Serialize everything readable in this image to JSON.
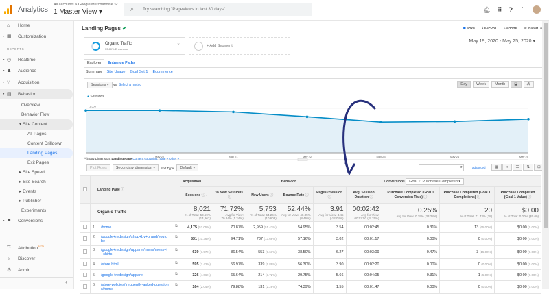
{
  "topbar": {
    "brand": "Analytics",
    "breadcrumb": "All accounts > Google Merchandise St...",
    "view": "1 Master View",
    "search_placeholder": "Try searching \"Pageviews in last 30 days\""
  },
  "sidebar": {
    "home": "Home",
    "customization": "Customization",
    "reports_header": "REPORTS",
    "realtime": "Realtime",
    "audience": "Audience",
    "acquisition": "Acquisition",
    "behavior": "Behavior",
    "overview": "Overview",
    "behavior_flow": "Behavior Flow",
    "site_content": "Site Content",
    "all_pages": "All Pages",
    "content_drilldown": "Content Drilldown",
    "landing_pages": "Landing Pages",
    "exit_pages": "Exit Pages",
    "site_speed": "Site Speed",
    "site_search": "Site Search",
    "events": "Events",
    "publisher": "Publisher",
    "experiments": "Experiments",
    "conversions": "Conversions",
    "attribution": "Attribution",
    "beta": "BETA",
    "discover": "Discover",
    "admin": "Admin"
  },
  "report": {
    "title": "Landing Pages",
    "save": "SAVE",
    "export": "EXPORT",
    "share": "SHARE",
    "insights": "INSIGHTS",
    "date_range": "May 19, 2020 - May 25, 2020"
  },
  "segments": {
    "name": "Organic Traffic",
    "detail": "53.60% Entrances",
    "add": "+ Add Segment"
  },
  "tabs": {
    "explorer": "Explorer",
    "entrance_paths": "Entrance Paths"
  },
  "subtabs": [
    "Summary",
    "Site Usage",
    "Goal Set 1",
    "Ecommerce"
  ],
  "chart_controls": {
    "metric": "Sessions",
    "vs": "vs.",
    "select_metric": "Select a metric",
    "day": "Day",
    "week": "Week",
    "month": "Month",
    "legend": "Sessions"
  },
  "chart_data": {
    "type": "area",
    "series": [
      {
        "name": "Sessions",
        "values": [
          1420,
          1420,
          1370,
          1210,
          1030,
          1050,
          1130
        ]
      }
    ],
    "x": [
      "May 19",
      "May 20",
      "May 21",
      "May 22",
      "May 23",
      "May 24",
      "May 25"
    ],
    "x_tick_labels": [
      "...",
      "May 20",
      "May 21",
      "May 22",
      "May 23",
      "May 24",
      "May 25"
    ],
    "y_ticks": [
      "1,500",
      "1,000",
      "500"
    ],
    "ylim": [
      0,
      1500
    ],
    "color": "#058dc7"
  },
  "dimension": {
    "label": "Primary Dimension:",
    "value": "Landing Page",
    "grouping": "Content Grouping: none",
    "other": "Other"
  },
  "controls": {
    "plot_rows": "Plot Rows",
    "secondary": "Secondary dimension",
    "sort_type": "Sort Type:",
    "sort_value": "Default",
    "advanced": "advanced"
  },
  "table": {
    "group_acq": "Acquisition",
    "group_beh": "Behavior",
    "group_conv": "Conversions",
    "goal_select": "Goal 1: Purchase Completed",
    "headers": [
      "Landing Page",
      "Sessions",
      "% New Sessions",
      "New Users",
      "Bounce Rate",
      "Pages / Session",
      "Avg. Session Duration",
      "Purchase Completed (Goal 1 Conversion Rate)",
      "Purchase Completed (Goal 1 Completions)",
      "Purchase Completed (Goal 1 Value)"
    ],
    "totals": {
      "label": "Organic Traffic",
      "values": [
        [
          "8,021",
          "% of Total: 53.59% (14,967)"
        ],
        [
          "71.72%",
          "Avg for View: 70.84% (1.24%)"
        ],
        [
          "5,753",
          "% of Total: 54.26% (10,603)"
        ],
        [
          "52.44%",
          "Avg for View: 48.35% (8.46%)"
        ],
        [
          "3.91",
          "Avg for View: 4.45 (-12.04%)"
        ],
        [
          "00:02:42",
          "Avg for View: 00:02:50 (-5.25%)"
        ],
        [
          "0.25%",
          "Avg for View: 0.19% (33.28%)"
        ],
        [
          "20",
          "% of Total: 71.43% (28)"
        ],
        [
          "$0.00",
          "% of Total: 0.00% ($0.00)"
        ]
      ]
    },
    "rows": [
      {
        "n": "1.",
        "page": "/home",
        "sessions": "4,175",
        "sp": "(52.05%)",
        "new": "70.87%",
        "users": "2,959",
        "up": "(51.43%)",
        "bounce": "54.95%",
        "pps": "3.54",
        "dur": "00:02:45",
        "cr": "0.31%",
        "comp": "13",
        "cp": "(65.00%)",
        "val": "$0.00",
        "vp": "(0.00%)"
      },
      {
        "n": "2.",
        "page": "/google+redesign/shop+by+brand/youtube",
        "sessions": "831",
        "sp": "(10.36%)",
        "new": "94.71%",
        "users": "787",
        "up": "(13.68%)",
        "bounce": "57.16%",
        "pps": "3.02",
        "dur": "00:01:17",
        "cr": "0.00%",
        "comp": "0",
        "cp": "(0.00%)",
        "val": "$0.00",
        "vp": "(0.00%)"
      },
      {
        "n": "3.",
        "page": "/google+redesign/apparel/mens/mens+t+shirts",
        "sessions": "639",
        "sp": "(7.97%)",
        "new": "86.54%",
        "users": "553",
        "up": "(9.61%)",
        "bounce": "38.50%",
        "pps": "6.27",
        "dur": "00:03:09",
        "cr": "0.47%",
        "comp": "3",
        "cp": "(15.00%)",
        "val": "$0.00",
        "vp": "(0.00%)"
      },
      {
        "n": "4.",
        "page": "/store.html",
        "sessions": "595",
        "sp": "(7.42%)",
        "new": "56.97%",
        "users": "339",
        "up": "(5.89%)",
        "bounce": "56.30%",
        "pps": "3.90",
        "dur": "00:02:20",
        "cr": "0.00%",
        "comp": "0",
        "cp": "(0.00%)",
        "val": "$0.00",
        "vp": "(0.00%)"
      },
      {
        "n": "5.",
        "page": "/google+redesign/apparel",
        "sessions": "326",
        "sp": "(4.06%)",
        "new": "65.64%",
        "users": "214",
        "up": "(3.72%)",
        "bounce": "29.75%",
        "pps": "5.66",
        "dur": "00:04:05",
        "cr": "0.31%",
        "comp": "1",
        "cp": "(5.00%)",
        "val": "$0.00",
        "vp": "(0.00%)"
      },
      {
        "n": "6.",
        "page": "/store-policies/frequently-asked-questions/home",
        "sessions": "164",
        "sp": "(2.04%)",
        "new": "79.88%",
        "users": "131",
        "up": "(2.28%)",
        "bounce": "74.39%",
        "pps": "1.55",
        "dur": "00:01:47",
        "cr": "0.00%",
        "comp": "0",
        "cp": "(0.00%)",
        "val": "$0.00",
        "vp": "(0.00%)"
      }
    ]
  }
}
